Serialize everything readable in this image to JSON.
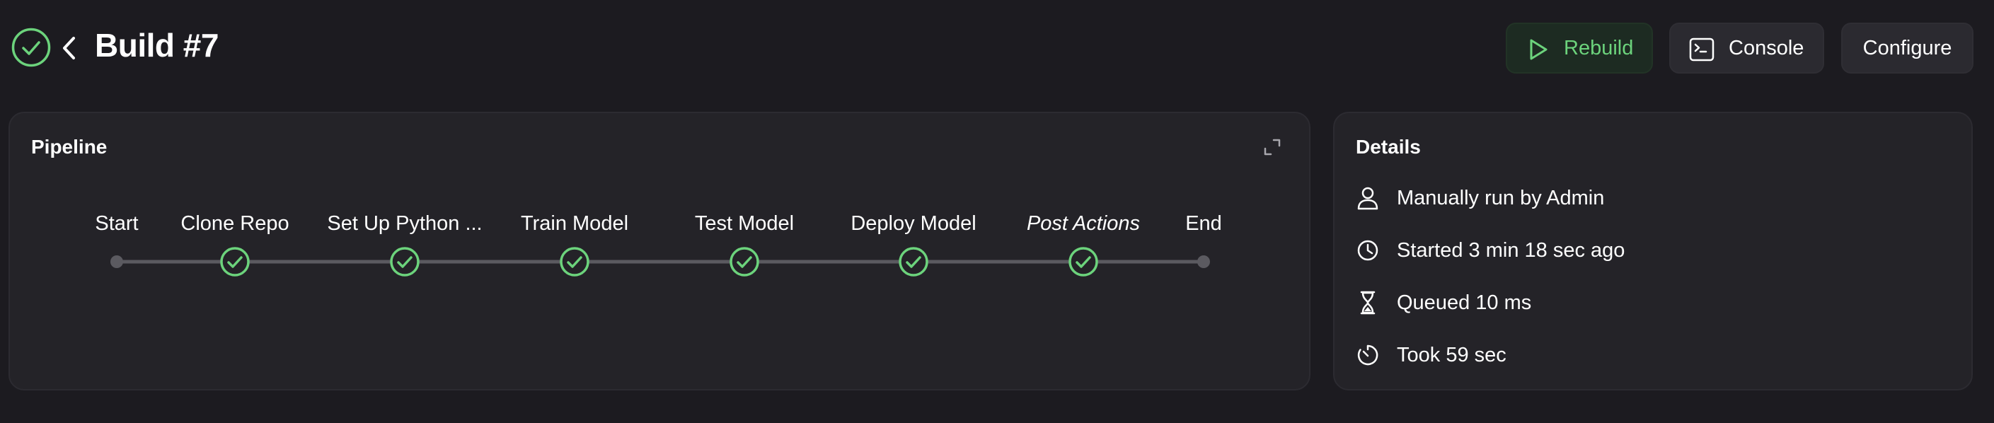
{
  "header": {
    "status": "success",
    "status_icon": "check-circle-icon",
    "back_icon": "chevron-left-icon",
    "title": "Build #7",
    "accent_color": "#6cd37c"
  },
  "actions": {
    "rebuild": {
      "label": "Rebuild",
      "icon": "play-icon"
    },
    "console": {
      "label": "Console",
      "icon": "terminal-icon"
    },
    "configure": {
      "label": "Configure"
    }
  },
  "pipeline": {
    "title": "Pipeline",
    "expand_icon": "expand-icon",
    "stages": [
      {
        "label": "Start",
        "kind": "terminal",
        "italic": false
      },
      {
        "label": "Clone Repo",
        "kind": "success",
        "italic": false
      },
      {
        "label": "Set Up Python ...",
        "kind": "success",
        "italic": false
      },
      {
        "label": "Train Model",
        "kind": "success",
        "italic": false
      },
      {
        "label": "Test Model",
        "kind": "success",
        "italic": false
      },
      {
        "label": "Deploy Model",
        "kind": "success",
        "italic": false
      },
      {
        "label": "Post Actions",
        "kind": "success",
        "italic": true
      },
      {
        "label": "End",
        "kind": "terminal",
        "italic": false
      }
    ]
  },
  "details": {
    "title": "Details",
    "items": [
      {
        "icon": "user-icon",
        "text": "Manually run by Admin"
      },
      {
        "icon": "clock-icon",
        "text": "Started 3 min 18 sec ago"
      },
      {
        "icon": "hourglass-icon",
        "text": "Queued 10 ms"
      },
      {
        "icon": "timer-icon",
        "text": "Took 59 sec"
      }
    ]
  }
}
